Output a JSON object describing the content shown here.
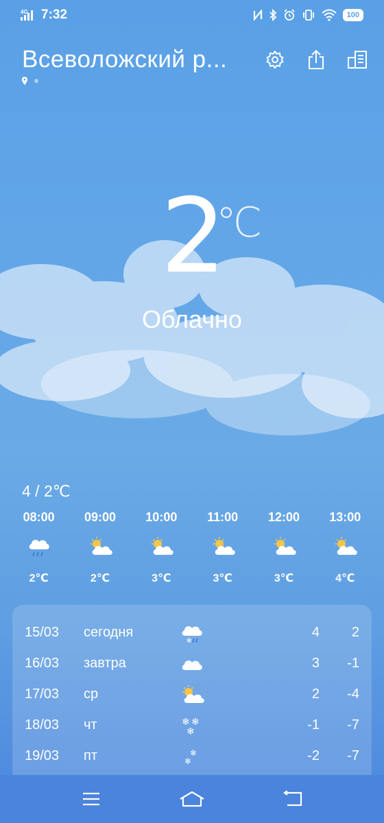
{
  "status": {
    "time": "7:32",
    "network": "4G",
    "battery": "100",
    "icons": [
      "nfc-icon",
      "bluetooth-icon",
      "alarm-icon",
      "vibrate-icon",
      "wifi-icon",
      "battery-icon"
    ]
  },
  "header": {
    "city": "Всеволожский р...",
    "icons": [
      "gear-icon",
      "share-icon",
      "city-list-icon"
    ]
  },
  "current": {
    "temperature": "2",
    "unit": "℃",
    "condition": "Облачно",
    "range": "4 / 2℃"
  },
  "hourly": [
    {
      "time": "08:00",
      "icon": "rain-cloud-icon",
      "temp": "2℃"
    },
    {
      "time": "09:00",
      "icon": "partly-cloudy-icon",
      "temp": "2℃"
    },
    {
      "time": "10:00",
      "icon": "partly-cloudy-icon",
      "temp": "3℃"
    },
    {
      "time": "11:00",
      "icon": "partly-cloudy-icon",
      "temp": "3℃"
    },
    {
      "time": "12:00",
      "icon": "partly-cloudy-icon",
      "temp": "3℃"
    },
    {
      "time": "13:00",
      "icon": "partly-cloudy-icon",
      "temp": "4℃"
    }
  ],
  "daily": [
    {
      "date": "15/03",
      "day": "сегодня",
      "icon": "sleet-cloud-icon",
      "high": "4",
      "low": "2"
    },
    {
      "date": "16/03",
      "day": "завтра",
      "icon": "cloud-icon",
      "high": "3",
      "low": "-1"
    },
    {
      "date": "17/03",
      "day": "ср",
      "icon": "partly-cloudy-icon",
      "high": "2",
      "low": "-4"
    },
    {
      "date": "18/03",
      "day": "чт",
      "icon": "snowflakes-icon",
      "high": "-1",
      "low": "-7"
    },
    {
      "date": "19/03",
      "day": "пт",
      "icon": "snowflakes-small-icon",
      "high": "-2",
      "low": "-7"
    }
  ],
  "nav": [
    "menu-icon",
    "home-icon",
    "back-icon"
  ],
  "colors": {
    "sun": "#f5c64a",
    "rain": "#3f7fd8"
  }
}
